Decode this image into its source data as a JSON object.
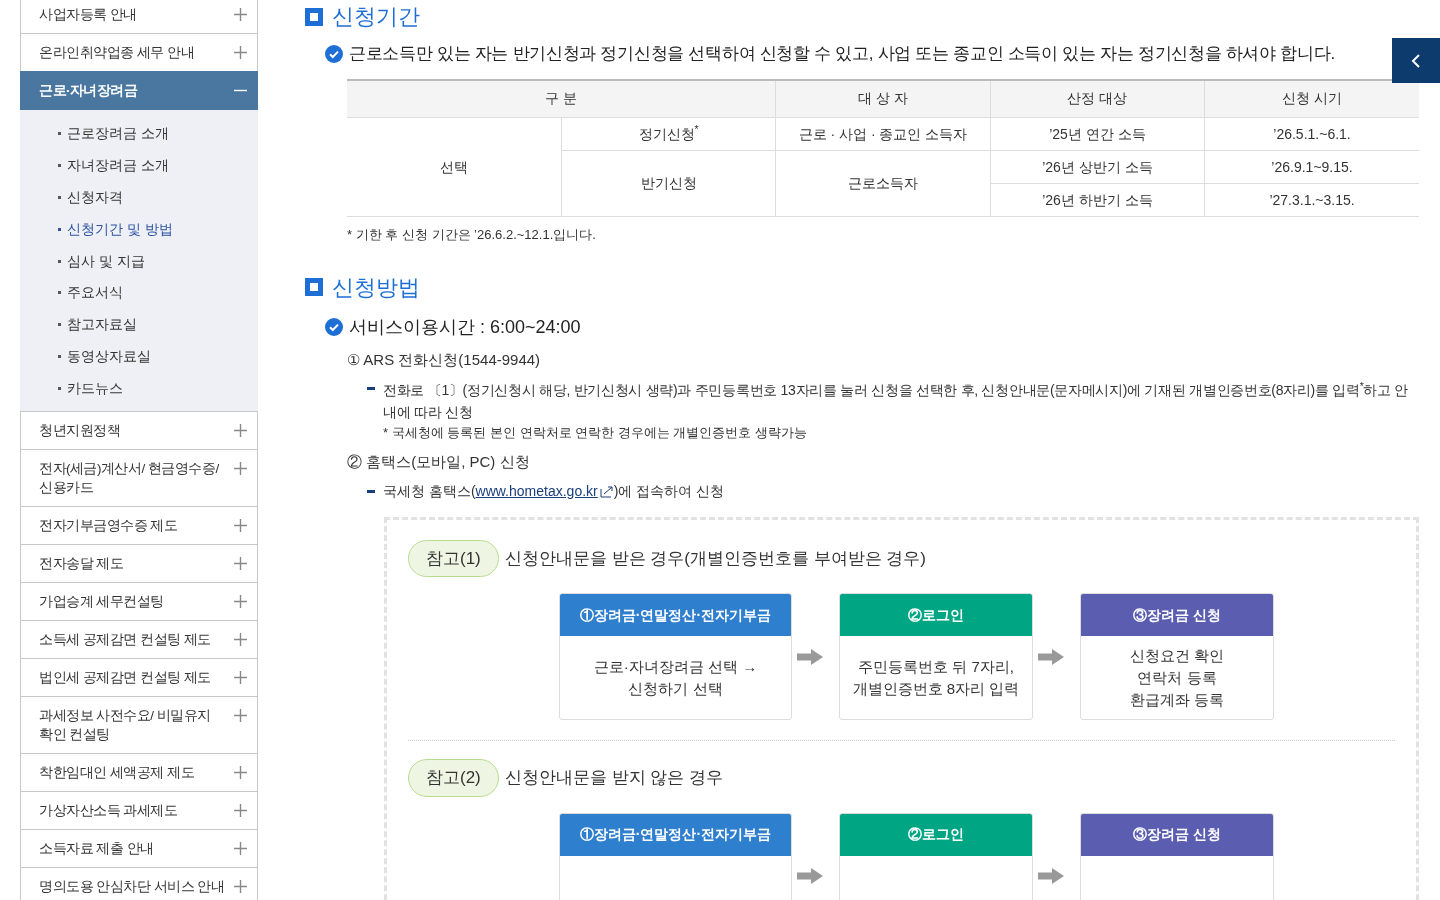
{
  "sidebar": {
    "items": [
      {
        "label": "사업자등록 안내",
        "expanded": false
      },
      {
        "label": "온라인취약업종 세무 안내",
        "expanded": false
      },
      {
        "label": "근로·자녀장려금",
        "expanded": true,
        "children": [
          {
            "label": "근로장려금 소개",
            "selected": false
          },
          {
            "label": "자녀장려금 소개",
            "selected": false
          },
          {
            "label": "신청자격",
            "selected": false
          },
          {
            "label": "신청기간 및 방법",
            "selected": true
          },
          {
            "label": "심사 및 지급",
            "selected": false
          },
          {
            "label": "주요서식",
            "selected": false
          },
          {
            "label": "참고자료실",
            "selected": false
          },
          {
            "label": "동영상자료실",
            "selected": false
          },
          {
            "label": "카드뉴스",
            "selected": false
          }
        ]
      },
      {
        "label": "청년지원정책",
        "expanded": false
      },
      {
        "label": "전자(세금)계산서/ 현금영수증/ 신용카드",
        "expanded": false
      },
      {
        "label": "전자기부금영수증 제도",
        "expanded": false
      },
      {
        "label": "전자송달 제도",
        "expanded": false
      },
      {
        "label": "가업승계 세무컨설팅",
        "expanded": false
      },
      {
        "label": "소득세 공제감면 컨설팅 제도",
        "expanded": false
      },
      {
        "label": "법인세 공제감면 컨설팅 제도",
        "expanded": false
      },
      {
        "label": "과세정보 사전수요/ 비밀유지 확인 컨설팅",
        "expanded": false
      },
      {
        "label": "착한임대인 세액공제 제도",
        "expanded": false
      },
      {
        "label": "가상자산소득 과세제도",
        "expanded": false
      },
      {
        "label": "소득자료 제출 안내",
        "expanded": false
      },
      {
        "label": "명의도용 안심차단 서비스 안내",
        "expanded": false
      }
    ]
  },
  "period": {
    "title": "신청기간",
    "note": "근로소득만 있는 자는 반기신청과 정기신청을 선택하여 신청할 수 있고, 사업 또는 종교인 소득이 있는 자는 정기신청을 하셔야 합니다.",
    "table": {
      "columns": [
        "구 분",
        "대 상 자",
        "산정 대상",
        "신청 시기"
      ],
      "group": "선택",
      "rows": [
        {
          "type": "정기신청$^{*}$",
          "target": "근로 · 사업 · 종교인 소득자",
          "periods": [
            {
              "basis": "’25년 연간 소득",
              "time": "’26.5.1.~6.1."
            }
          ]
        },
        {
          "type": "반기신청",
          "target": "근로소득자",
          "periods": [
            {
              "basis": "’26년 상반기 소득",
              "time": "’26.9.1~9.15."
            },
            {
              "basis": "’26년 하반기 소득",
              "time": "’27.3.1.~3.15."
            }
          ]
        }
      ]
    },
    "footnote": "* 기한 후 신청 기간은 ’26.6.2.~12.1.입니다."
  },
  "method": {
    "title": "신청방법",
    "note": "서비스이용시간 : 6:00~24:00",
    "ways": [
      {
        "num": "①",
        "title": "ARS 전화신청(1544-9944)",
        "bullets": [
          {
            "kind": "text",
            "text": "전화로 〔1〕(정기신청시 해당, 반기신청시 생략)과 주민등록번호 13자리를 눌러 신청을 선택한 후, 신청안내문(문자메시지)에 기재된 개별인증번호(8자리)를 입력$^{*}$하고 안내에 따라 신청",
            "note": "* 국세청에 등록된 본인 연락처로 연락한 경우에는 개별인증번호 생략가능"
          }
        ]
      },
      {
        "num": "②",
        "title": "홈택스(모바일, PC) 신청",
        "bullets": [
          {
            "kind": "link",
            "before": "국세청 홈택스(",
            "link": "www.hometax.go.kr",
            "after": ")에 접속하여 신청"
          }
        ]
      }
    ]
  },
  "references": [
    {
      "badge": "참고(1)",
      "title": "신청안내문을 받은 경우(개별인증번호를 부여받은 경우)",
      "steps": [
        {
          "header": "①장려금·연말정산·전자기부금",
          "color": "#2f7fcf",
          "body": [
            "근로·자녀장려금 선택 →",
            "신청하기 선택"
          ]
        },
        {
          "header": "②로그인",
          "color": "#00a584",
          "body": [
            "주민등록번호 뒤 7자리,",
            "개별인증번호 8자리 입력"
          ]
        },
        {
          "header": "③장려금 신청",
          "color": "#5a5db0",
          "body": [
            "신청요건 확인",
            "연락처 등록",
            "환급계좌 등록"
          ]
        }
      ]
    },
    {
      "badge": "참고(2)",
      "title": "신청안내문을 받지 않은 경우",
      "steps": [
        {
          "header": "①장려금·연말정산·전자기부금",
          "color": "#2f7fcf"
        },
        {
          "header": "②로그인",
          "color": "#00a584"
        },
        {
          "header": "③장려금 신청",
          "color": "#5a5db0"
        }
      ]
    }
  ]
}
